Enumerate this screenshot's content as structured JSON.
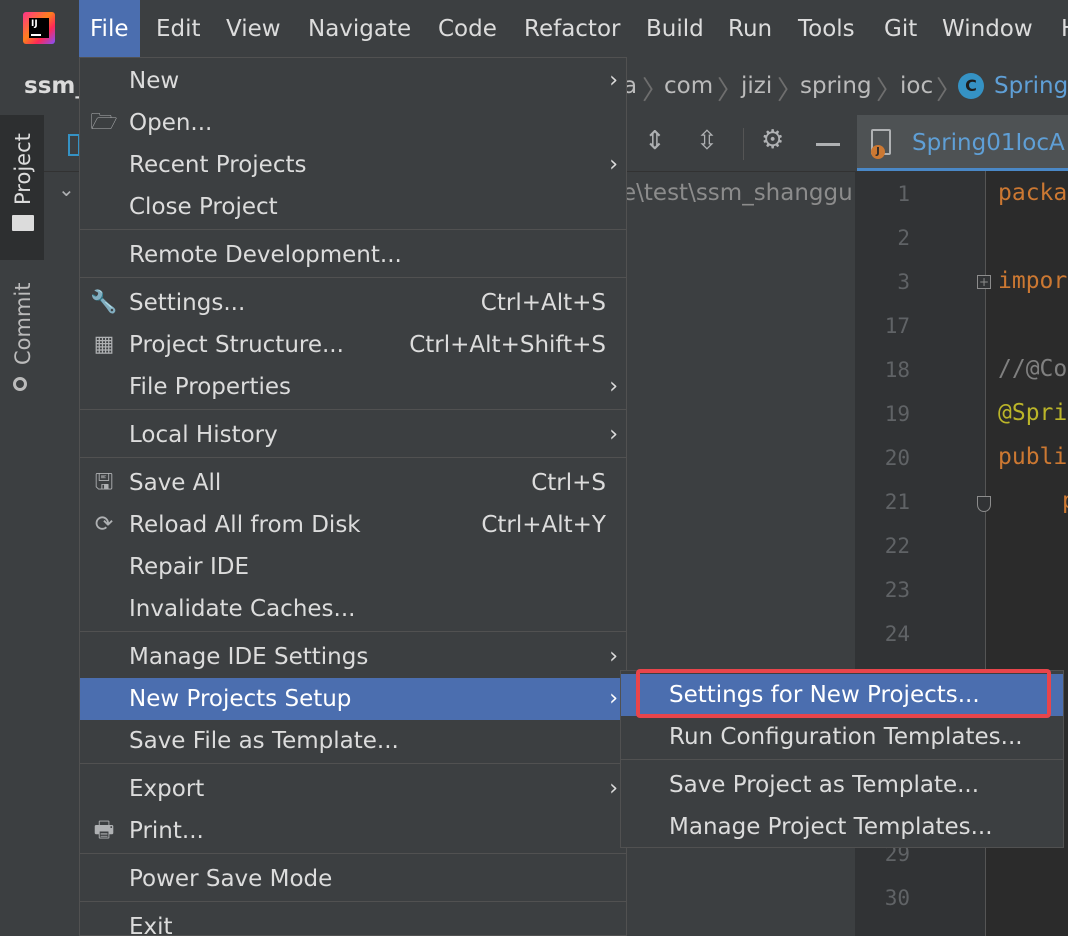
{
  "menubar": {
    "items": [
      "File",
      "Edit",
      "View",
      "Navigate",
      "Code",
      "Refactor",
      "Build",
      "Run",
      "Tools",
      "Git",
      "Window",
      "H"
    ]
  },
  "breadcrumbs": {
    "project": "ssm_",
    "path": [
      "a",
      "com",
      "jizi",
      "spring",
      "ioc",
      "Spring"
    ]
  },
  "tool_windows": {
    "project": "Project",
    "commit": "Commit"
  },
  "project_panel": {
    "path_fragment": "e\\test\\ssm_shanggu"
  },
  "editor": {
    "tab_label": "Spring01IocA",
    "line_numbers": [
      "1",
      "2",
      "3",
      "17",
      "18",
      "19",
      "20",
      "21",
      "22",
      "23",
      "24",
      "29",
      "30"
    ],
    "code": [
      "packa",
      "impor",
      "//@Co",
      "@Spri",
      "publi",
      "p"
    ]
  },
  "file_menu": {
    "new": "New",
    "open": "Open...",
    "recent_projects": "Recent Projects",
    "close_project": "Close Project",
    "remote_development": "Remote Development...",
    "settings": "Settings...",
    "settings_shortcut": "Ctrl+Alt+S",
    "project_structure": "Project Structure...",
    "project_structure_shortcut": "Ctrl+Alt+Shift+S",
    "file_properties": "File Properties",
    "local_history": "Local History",
    "save_all": "Save All",
    "save_all_shortcut": "Ctrl+S",
    "reload_all": "Reload All from Disk",
    "reload_all_shortcut": "Ctrl+Alt+Y",
    "repair_ide": "Repair IDE",
    "invalidate_caches": "Invalidate Caches...",
    "manage_ide_settings": "Manage IDE Settings",
    "new_projects_setup": "New Projects Setup",
    "save_file_as_template": "Save File as Template...",
    "export": "Export",
    "print": "Print...",
    "power_save_mode": "Power Save Mode",
    "exit": "Exit"
  },
  "submenu": {
    "settings_for_new_projects": "Settings for New Projects...",
    "run_configuration_templates": "Run Configuration Templates...",
    "save_project_as_template": "Save Project as Template...",
    "manage_project_templates": "Manage Project Templates..."
  },
  "colors": {
    "menu_highlight": "#4b6eaf",
    "annotation_box": "#e8454b",
    "keyword": "#cc7832",
    "annotation": "#bbb529",
    "comment": "#808080"
  }
}
